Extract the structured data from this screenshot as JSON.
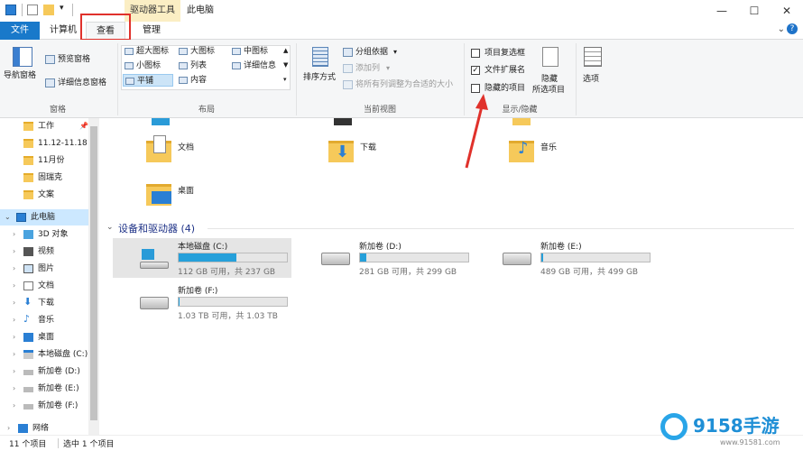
{
  "titlebar": {
    "context_tool": "驱动器工具",
    "window_title": "此电脑",
    "buttons": {
      "minimize": "—",
      "maximize": "☐",
      "close": "✕"
    }
  },
  "tabs": {
    "file": "文件",
    "computer": "计算机",
    "view": "查看",
    "manage": "管理",
    "chevron": "⌄",
    "help": "?"
  },
  "ribbon": {
    "panes": {
      "group_label": "窗格",
      "nav_pane": "导航窗格",
      "preview_pane": "预览窗格",
      "details_pane": "详细信息窗格"
    },
    "layout": {
      "group_label": "布局",
      "items": [
        "超大图标",
        "大图标",
        "中图标",
        "小图标",
        "列表",
        "详细信息",
        "平铺",
        "内容"
      ]
    },
    "current_view": {
      "group_label": "当前视图",
      "sort_by": "排序方式",
      "group_by": "分组依据",
      "add_columns": "添加列",
      "size_all_columns": "将所有列调整为合适的大小"
    },
    "show_hide": {
      "group_label": "显示/隐藏",
      "item_checkboxes": "项目复选框",
      "file_extensions": "文件扩展名",
      "hidden_items": "隐藏的项目",
      "hide_selected_1": "隐藏",
      "hide_selected_2": "所选项目",
      "item_checkboxes_checked": false,
      "file_extensions_checked": true,
      "hidden_items_checked": false
    },
    "options": "选项"
  },
  "nav": {
    "quick": [
      "工作",
      "11.12-11.18",
      "11月份",
      "固瑞克",
      "文案"
    ],
    "this_pc": "此电脑",
    "pc_items": [
      "3D 对象",
      "视频",
      "图片",
      "文档",
      "下载",
      "音乐",
      "桌面",
      "本地磁盘 (C:)",
      "新加卷 (D:)",
      "新加卷 (E:)",
      "新加卷 (F:)"
    ],
    "network": "网络"
  },
  "folders": [
    "文档",
    "下载",
    "音乐",
    "桌面"
  ],
  "devices_header": "设备和驱动器 (4)",
  "drives": [
    {
      "name": "本地磁盘 (C:)",
      "free": "112 GB 可用，共 237 GB",
      "used_fraction": 0.53
    },
    {
      "name": "新加卷 (D:)",
      "free": "281 GB 可用，共 299 GB",
      "used_fraction": 0.06
    },
    {
      "name": "新加卷 (E:)",
      "free": "489 GB 可用，共 499 GB",
      "used_fraction": 0.02
    },
    {
      "name": "新加卷 (F:)",
      "free": "1.03 TB 可用，共 1.03 TB",
      "used_fraction": 0.01
    }
  ],
  "status": {
    "count": "11 个项目",
    "selected": "选中 1 个项目"
  },
  "watermark": {
    "brand": "9158手游",
    "url": "www.91581.com"
  },
  "colors": {
    "accent": "#1979ca",
    "highlight": "#e0312b",
    "bar": "#26a0da"
  }
}
